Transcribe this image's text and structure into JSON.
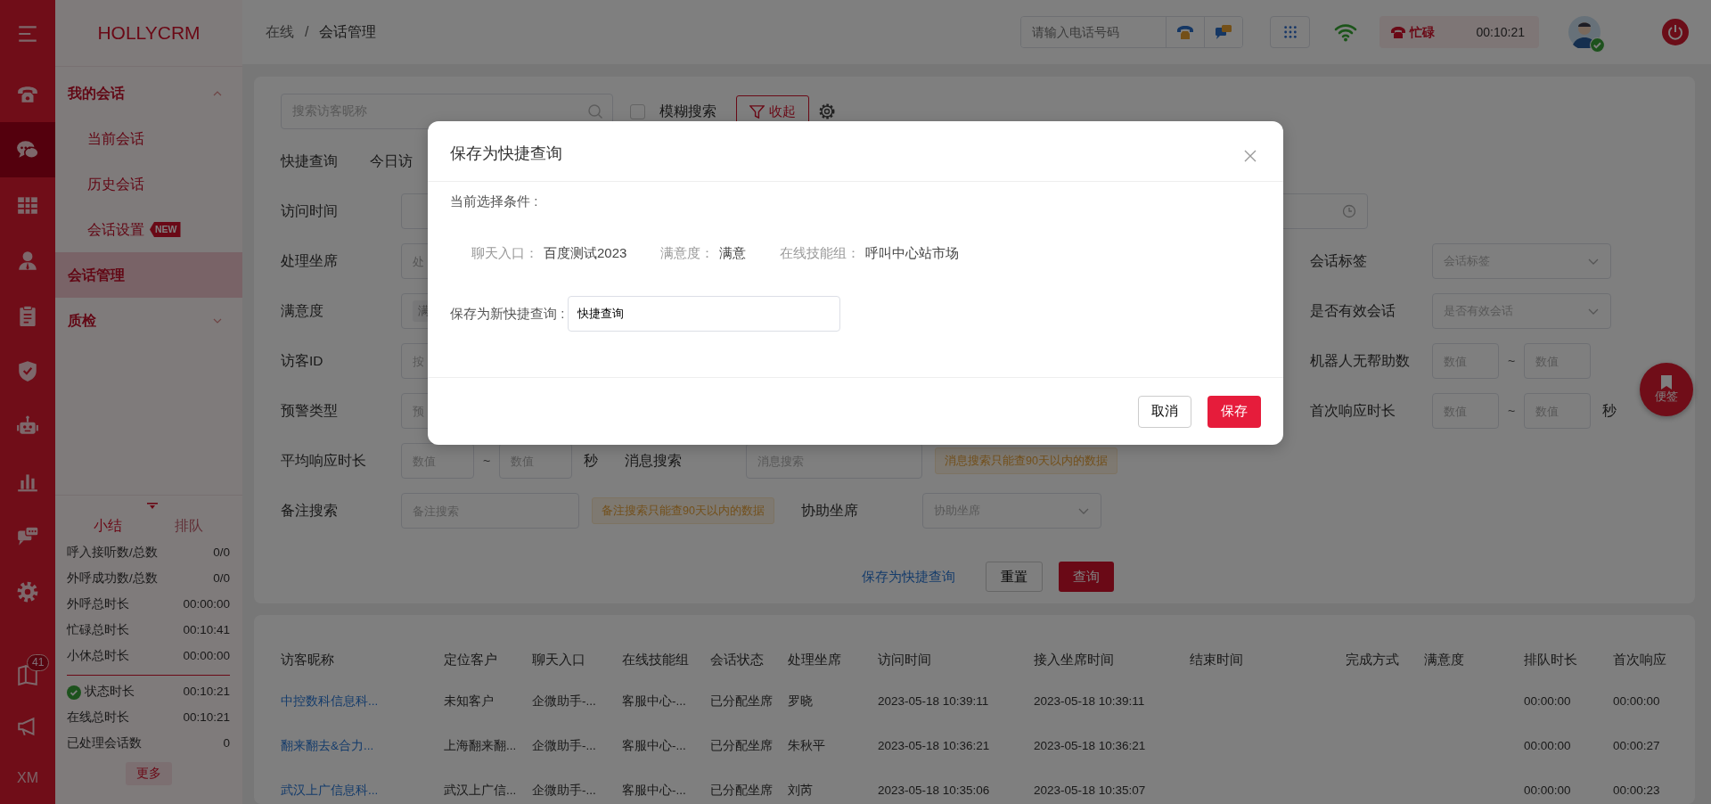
{
  "rail": {
    "items": [
      {
        "selected": false
      },
      {
        "selected": true
      },
      {
        "selected": false
      },
      {
        "selected": false
      },
      {
        "selected": false
      },
      {
        "selected": false
      },
      {
        "selected": false
      },
      {
        "selected": false
      },
      {
        "selected": false
      },
      {
        "selected": false
      }
    ],
    "notification_count": "41",
    "user_initials": "XM"
  },
  "sidebar": {
    "logo": "HOLLYCRM",
    "menu": [
      {
        "label": "我的会话",
        "expanded": true,
        "selected": false,
        "children": [
          {
            "label": "当前会话",
            "selected": false
          },
          {
            "label": "历史会话",
            "selected": false
          },
          {
            "label": "会话设置",
            "badge": "NEW",
            "selected": false
          }
        ]
      },
      {
        "label": "会话管理",
        "selected": true
      },
      {
        "label": "质检",
        "expanded": false,
        "selected": false
      }
    ],
    "stats": {
      "tabs": [
        {
          "label": "小结",
          "selected": true
        },
        {
          "label": "排队",
          "selected": false
        }
      ],
      "rows": [
        {
          "label": "呼入接听数/总数",
          "value": "0/0"
        },
        {
          "label": "外呼成功数/总数",
          "value": "0/0"
        },
        {
          "label": "外呼总时长",
          "value": "00:00:00"
        },
        {
          "label": "忙碌总时长",
          "value": "00:10:41"
        },
        {
          "label": "小休总时长",
          "value": "00:00:00"
        }
      ],
      "status_rows": [
        {
          "label": "状态时长",
          "value": "00:10:21",
          "online": true
        },
        {
          "label": "在线总时长",
          "value": "00:10:21",
          "online": false
        },
        {
          "label": "已处理会话数",
          "value": "0",
          "online": false
        }
      ],
      "more": "更多"
    }
  },
  "header": {
    "breadcrumb": [
      "在线",
      "会话管理"
    ],
    "breadcrumb_separator": "/",
    "phone_placeholder": "请输入电话号码",
    "status": {
      "label": "忙碌",
      "timer": "00:10:21"
    },
    "user_online": true
  },
  "filters": {
    "search": {
      "placeholder": "搜索访客昵称"
    },
    "fuzzy": {
      "label": "模糊搜索",
      "checked": false
    },
    "collapse_button": "收起",
    "rows": [
      {
        "left": [
          {
            "kind": "quick_label",
            "text": "快捷查询"
          },
          {
            "kind": "quick",
            "text": "今日访"
          }
        ]
      },
      {
        "left": [
          {
            "kind": "label",
            "text": "访问时间"
          },
          {
            "kind": "datetime"
          }
        ]
      },
      {
        "left": [
          {
            "kind": "label",
            "text": "处理坐席"
          },
          {
            "kind": "input",
            "placeholder": "处"
          }
        ],
        "right": [
          {
            "kind": "label",
            "text": "会话标签"
          },
          {
            "kind": "select",
            "placeholder": "会话标签"
          }
        ]
      },
      {
        "left": [
          {
            "kind": "label",
            "text": "满意度"
          },
          {
            "kind": "tags",
            "tags": [
              "满"
            ]
          }
        ],
        "right": [
          {
            "kind": "label",
            "text": "是否有效会话"
          },
          {
            "kind": "select",
            "placeholder": "是否有效会话"
          }
        ]
      },
      {
        "left": [
          {
            "kind": "label",
            "text": "访客ID"
          },
          {
            "kind": "input",
            "placeholder": "按"
          }
        ],
        "right": [
          {
            "kind": "label",
            "text": "机器人无帮助数"
          },
          {
            "kind": "range",
            "from": {
              "placeholder": "数值"
            },
            "separator": "~",
            "to": {
              "placeholder": "数值"
            }
          }
        ]
      },
      {
        "left": [
          {
            "kind": "label",
            "text": "预警类型"
          },
          {
            "kind": "input",
            "placeholder": "预"
          }
        ],
        "right": [
          {
            "kind": "label",
            "text": "首次响应时长"
          },
          {
            "kind": "range",
            "from": {
              "placeholder": "数值"
            },
            "separator": "~",
            "to": {
              "placeholder": "数值"
            }
          },
          {
            "kind": "unit",
            "text": "秒"
          }
        ]
      },
      {
        "left": [
          {
            "kind": "label",
            "text": "平均响应时长"
          },
          {
            "kind": "range",
            "from": {
              "placeholder": "数值"
            },
            "separator": "~",
            "to": {
              "placeholder": "数值"
            }
          },
          {
            "kind": "unit",
            "text": "秒"
          },
          {
            "kind": "label",
            "text": "消息搜索"
          },
          {
            "kind": "input",
            "placeholder": "消息搜索"
          },
          {
            "kind": "warning",
            "text": "消息搜索只能查90天以内的数据"
          }
        ]
      },
      {
        "left": [
          {
            "kind": "label",
            "text": "备注搜索"
          },
          {
            "kind": "input",
            "placeholder": "备注搜索"
          },
          {
            "kind": "warning",
            "text": "备注搜索只能查90天以内的数据"
          },
          {
            "kind": "label",
            "text": "协助坐席"
          },
          {
            "kind": "select",
            "placeholder": "协助坐席"
          }
        ]
      }
    ],
    "actions": {
      "save_link": "保存为快捷查询",
      "reset": "重置",
      "query": "查询"
    }
  },
  "float_button": {
    "label": "便签"
  },
  "table": {
    "columns": [
      "访客昵称",
      "定位客户",
      "聊天入口",
      "在线技能组",
      "会话状态",
      "处理坐席",
      "访问时间",
      "接入坐席时间",
      "结束时间",
      "完成方式",
      "满意度",
      "排队时长",
      "首次响应"
    ],
    "rows": [
      {
        "nickname": "中控数科信息科...",
        "customer": "未知客户",
        "entry": "企微助手-...",
        "skill_group": "客服中心-...",
        "status": "已分配坐席",
        "agent": "罗晓",
        "visit_time": "2023-05-18 10:39:11",
        "join_time": "2023-05-18 10:39:11",
        "queue_time": "00:00:00",
        "first_response": "00:00:00"
      },
      {
        "nickname": "翻来翻去&合力...",
        "customer": "上海翻来翻...",
        "entry": "企微助手-...",
        "skill_group": "客服中心-...",
        "status": "已分配坐席",
        "agent": "朱秋平",
        "visit_time": "2023-05-18 10:36:21",
        "join_time": "2023-05-18 10:36:21",
        "queue_time": "00:00:00",
        "first_response": "00:00:27"
      },
      {
        "nickname": "武汉上广信息科...",
        "customer": "武汉上广信...",
        "entry": "企微助手-...",
        "skill_group": "客服中心-...",
        "status": "已分配坐席",
        "agent": "刘芮",
        "visit_time": "2023-05-18 10:35:06",
        "join_time": "2023-05-18 10:35:07",
        "queue_time": "00:00:00",
        "first_response": "00:00:23"
      }
    ]
  },
  "modal": {
    "title": "保存为快捷查询",
    "conditions_label": "当前选择条件 :",
    "conditions": [
      {
        "name": "聊天入口：",
        "value": "百度测试2023"
      },
      {
        "name": "满意度：",
        "value": "满意"
      },
      {
        "name": "在线技能组：",
        "value": "呼叫中心站市场"
      }
    ],
    "name_label": "保存为新快捷查询 :",
    "name_value": "快捷查询",
    "cancel": "取消",
    "save": "保存"
  }
}
